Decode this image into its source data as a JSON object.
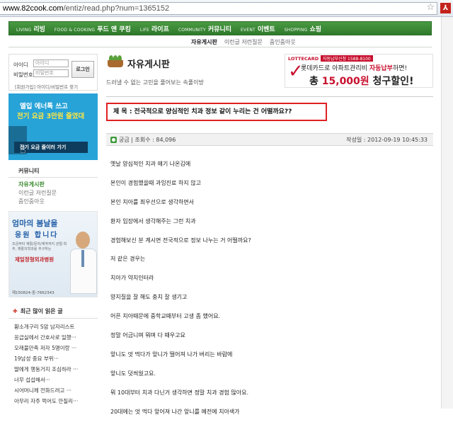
{
  "browser": {
    "url_host": "www.82cook.com",
    "url_path": "/entiz/read.php?num=1365152"
  },
  "nav": {
    "items": [
      {
        "en": "LIVING",
        "ko": "리빙"
      },
      {
        "en": "FOOD & COOKING",
        "ko": "푸드 앤 쿠킹"
      },
      {
        "en": "LIFE",
        "ko": "라이프"
      },
      {
        "en": "COMMUNITY",
        "ko": "커뮤니티"
      },
      {
        "en": "EVENT",
        "ko": "이벤트"
      },
      {
        "en": "SHOPPING",
        "ko": "쇼핑"
      }
    ],
    "sub": [
      "자유게시판",
      "이런글 저런질문",
      "줌인줌아웃"
    ]
  },
  "login": {
    "id_label": "아이디",
    "id_placeholder": "아이디",
    "pw_label": "비밀번호",
    "pw_placeholder": "비밀번호",
    "button": "로그인",
    "links": "[회원가입]   아이디/비밀번호 찾기"
  },
  "banner_energy": {
    "line1": "엘입 에너톡 쓰고",
    "line2": "전기 요금 3만원 줄였대",
    "button": "전기 요금 줄이러 가기"
  },
  "community": {
    "title": "커뮤니티",
    "items": [
      "자유게시판",
      "이런글 저런질문",
      "줌인줌아웃"
    ]
  },
  "banner_clinic": {
    "line1": "엄마의 봄날을",
    "line2": "응원 합니다",
    "line3": "조금부터 재활/문자/계약까지 관절·척추, 재활의학과를 추구하는",
    "line4": "제일정형외과병원",
    "footer": "제150824-중-7662343"
  },
  "popular": {
    "title": "최근 많이 읽은 글",
    "items": [
      "황소개구리 S암 남자리스트",
      "응급실에서 간호사로 일했···",
      "오래불만족 저자 5명이랑 ···",
      "19남성 중요 부위···",
      "딸에게 행동거지 조심하라 ···",
      "너무 섭섭해서···",
      "시어머니께 전화드려고 ···",
      "아무리 자주 먹어도 안질리···"
    ]
  },
  "board": {
    "title": "자유게시판",
    "subtitle": "드러낼 수 없는 고민을 풀어보는 속풀이방"
  },
  "ad": {
    "logo": "LOTTECARD",
    "tag": "자동납부신청 1588-8100",
    "line2_pre": "롯데카드",
    "line2_mid": "로 아파트관리비 ",
    "line2_em": "자동납부",
    "line2_post": "하면!",
    "line3_pre": "총 ",
    "line3_amount": "15,000원",
    "line3_post": " 청구할인!"
  },
  "post": {
    "subject": "제 목 : 전국적으로 양심적인 치과 정보 같이 누리는 건 어떨까요??",
    "author_views": "궁금  |  조회수 : 84,096",
    "date": "작성일 : 2012-09-19 10:45:33",
    "lines": [
      "옛날 양심적인 치과 얘기 나온김에",
      "본인이 경험했을때 과잉진료 하지 않고",
      "본인 치아를 최우선으로 생각하면서",
      "환자 입장에서 생각해주는 그런 치과",
      "경험해보신 분 계시면   전국적으로 정보 나누는 거 어떨까요?",
      "저 같은 경우는",
      "치아가 약치인터라",
      "양치질을 잘 해도 충치 잘 생기고",
      "어픈 치아때문에 중학교때부터 고생 좀 했어요.",
      "정말 어금니며 뭐며 다 때우고요",
      "앞니도 엇 먹다가 앞니가 떨어져 나가 버리는 바람에",
      "앞니도 덧씌웠고요.",
      "뭐 10대부터 치과 다닌거 생각하면 정말 치과 경험 많아요.",
      "20대에는 엇 먹다 앞어져 나간 앞니를 예전에 치아색가"
    ]
  }
}
